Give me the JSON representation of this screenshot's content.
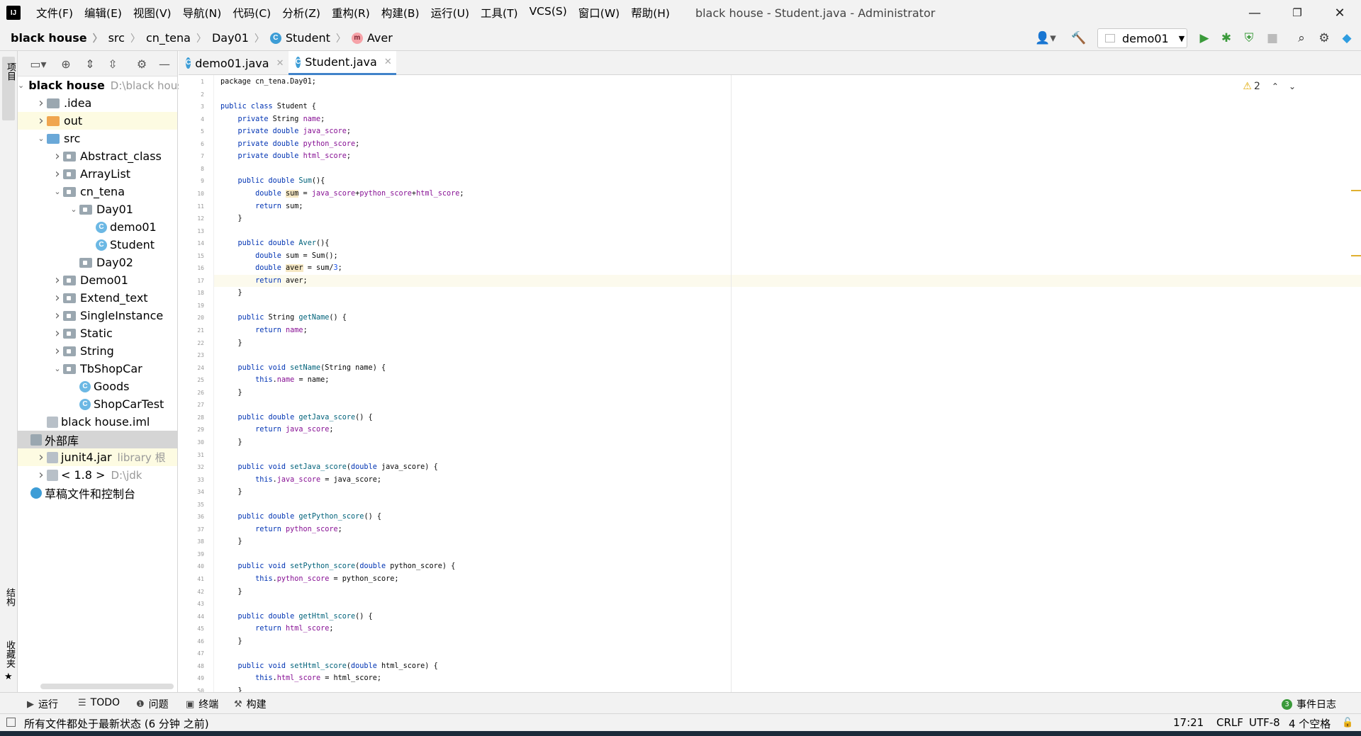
{
  "window": {
    "title": "black house - Student.java - Administrator",
    "menus": [
      "文件(F)",
      "编辑(E)",
      "视图(V)",
      "导航(N)",
      "代码(C)",
      "分析(Z)",
      "重构(R)",
      "构建(B)",
      "运行(U)",
      "工具(T)",
      "VCS(S)",
      "窗口(W)",
      "帮助(H)"
    ],
    "controls": {
      "minimize": "—",
      "restore": "❐",
      "close": "✕"
    }
  },
  "breadcrumb": {
    "project": "black house",
    "items": [
      "src",
      "cn_tena",
      "Day01",
      "Student",
      "Aver"
    ],
    "class_badge": "C",
    "method_badge": "m"
  },
  "toolbar": {
    "run_config": "demo01",
    "icons": [
      "user-icon",
      "hammer-icon",
      "run-icon",
      "debug-icon",
      "coverage-icon",
      "stop-icon",
      "search-icon",
      "gear-icon",
      "plugin-icon"
    ]
  },
  "left_strip": {
    "project_label": "项目",
    "structure_label": "结构",
    "favorites_label": "收藏夹"
  },
  "project_tree": [
    {
      "label": "black house",
      "hint": "D:\\black house",
      "indent": 0,
      "arrow": "down",
      "icon": "folder-gray",
      "bold": true
    },
    {
      "label": ".idea",
      "indent": 1,
      "arrow": "right",
      "icon": "folder-gray"
    },
    {
      "label": "out",
      "indent": 1,
      "arrow": "right",
      "icon": "folder-orange",
      "highlight": true
    },
    {
      "label": "src",
      "indent": 1,
      "arrow": "down",
      "icon": "folder-blue"
    },
    {
      "label": "Abstract_class",
      "indent": 2,
      "arrow": "right",
      "icon": "package"
    },
    {
      "label": "ArrayList",
      "indent": 2,
      "arrow": "right",
      "icon": "package"
    },
    {
      "label": "cn_tena",
      "indent": 2,
      "arrow": "down",
      "icon": "package"
    },
    {
      "label": "Day01",
      "indent": 3,
      "arrow": "down",
      "icon": "package"
    },
    {
      "label": "demo01",
      "indent": 4,
      "arrow": "",
      "icon": "class-run"
    },
    {
      "label": "Student",
      "indent": 4,
      "arrow": "",
      "icon": "class"
    },
    {
      "label": "Day02",
      "indent": 3,
      "arrow": "",
      "icon": "package"
    },
    {
      "label": "Demo01",
      "indent": 2,
      "arrow": "right",
      "icon": "package"
    },
    {
      "label": "Extend_text",
      "indent": 2,
      "arrow": "right",
      "icon": "package"
    },
    {
      "label": "SingleInstance",
      "indent": 2,
      "arrow": "right",
      "icon": "package"
    },
    {
      "label": "Static",
      "indent": 2,
      "arrow": "right",
      "icon": "package"
    },
    {
      "label": "String",
      "indent": 2,
      "arrow": "right",
      "icon": "package"
    },
    {
      "label": "TbShopCar",
      "indent": 2,
      "arrow": "down",
      "icon": "package"
    },
    {
      "label": "Goods",
      "indent": 3,
      "arrow": "",
      "icon": "class"
    },
    {
      "label": "ShopCarTest",
      "indent": 3,
      "arrow": "",
      "icon": "class-run"
    },
    {
      "label": "black house.iml",
      "indent": 1,
      "arrow": "",
      "icon": "iml"
    },
    {
      "label": "外部库",
      "indent": 0,
      "arrow": "",
      "icon": "library",
      "selected": true
    },
    {
      "label": "junit4.jar",
      "hint": "library 根",
      "indent": 1,
      "arrow": "right",
      "icon": "jar",
      "highlight": true
    },
    {
      "label": "< 1.8 >",
      "hint": "D:\\jdk",
      "indent": 1,
      "arrow": "right",
      "icon": "jdk"
    },
    {
      "label": "草稿文件和控制台",
      "indent": 0,
      "arrow": "",
      "icon": "scratch"
    }
  ],
  "tabs": [
    {
      "label": "demo01.java",
      "active": false
    },
    {
      "label": "Student.java",
      "active": true
    }
  ],
  "editor": {
    "warnings": "2",
    "current_line": 17,
    "lines": [
      [
        [
          "t",
          "package cn_tena.Day01;"
        ]
      ],
      [],
      [
        [
          "k",
          "public class "
        ],
        [
          "t",
          "Student {"
        ]
      ],
      [
        [
          "t",
          "    "
        ],
        [
          "k",
          "private "
        ],
        [
          "t",
          "String "
        ],
        [
          "f",
          "name"
        ],
        [
          "t",
          ";"
        ]
      ],
      [
        [
          "t",
          "    "
        ],
        [
          "k",
          "private double "
        ],
        [
          "f",
          "java_score"
        ],
        [
          "t",
          ";"
        ]
      ],
      [
        [
          "t",
          "    "
        ],
        [
          "k",
          "private double "
        ],
        [
          "f",
          "python_score"
        ],
        [
          "t",
          ";"
        ]
      ],
      [
        [
          "t",
          "    "
        ],
        [
          "k",
          "private double "
        ],
        [
          "f",
          "html_score"
        ],
        [
          "t",
          ";"
        ]
      ],
      [],
      [
        [
          "t",
          "    "
        ],
        [
          "k",
          "public double "
        ],
        [
          "m",
          "Sum"
        ],
        [
          "t",
          "(){"
        ]
      ],
      [
        [
          "t",
          "        "
        ],
        [
          "k",
          "double "
        ],
        [
          "h",
          "sum"
        ],
        [
          "t",
          " = "
        ],
        [
          "f",
          "java_score"
        ],
        [
          "t",
          "+"
        ],
        [
          "f",
          "python_score"
        ],
        [
          "t",
          "+"
        ],
        [
          "f",
          "html_score"
        ],
        [
          "t",
          ";"
        ]
      ],
      [
        [
          "t",
          "        "
        ],
        [
          "k",
          "return "
        ],
        [
          "t",
          "sum;"
        ]
      ],
      [
        [
          "t",
          "    }"
        ]
      ],
      [],
      [
        [
          "t",
          "    "
        ],
        [
          "k",
          "public double "
        ],
        [
          "m",
          "Aver"
        ],
        [
          "t",
          "(){"
        ]
      ],
      [
        [
          "t",
          "        "
        ],
        [
          "k",
          "double "
        ],
        [
          "t",
          "sum = Sum();"
        ]
      ],
      [
        [
          "t",
          "        "
        ],
        [
          "k",
          "double "
        ],
        [
          "h",
          "aver"
        ],
        [
          "t",
          " = sum/"
        ],
        [
          "n",
          "3"
        ],
        [
          "t",
          ";"
        ]
      ],
      [
        [
          "t",
          "        "
        ],
        [
          "k",
          "return "
        ],
        [
          "t",
          "aver;"
        ]
      ],
      [
        [
          "t",
          "    }"
        ]
      ],
      [],
      [
        [
          "t",
          "    "
        ],
        [
          "k",
          "public "
        ],
        [
          "t",
          "String "
        ],
        [
          "m",
          "getName"
        ],
        [
          "t",
          "() {"
        ]
      ],
      [
        [
          "t",
          "        "
        ],
        [
          "k",
          "return "
        ],
        [
          "f",
          "name"
        ],
        [
          "t",
          ";"
        ]
      ],
      [
        [
          "t",
          "    }"
        ]
      ],
      [],
      [
        [
          "t",
          "    "
        ],
        [
          "k",
          "public void "
        ],
        [
          "m",
          "setName"
        ],
        [
          "t",
          "(String name) {"
        ]
      ],
      [
        [
          "t",
          "        "
        ],
        [
          "k",
          "this"
        ],
        [
          "t",
          "."
        ],
        [
          "f",
          "name"
        ],
        [
          "t",
          " = name;"
        ]
      ],
      [
        [
          "t",
          "    }"
        ]
      ],
      [],
      [
        [
          "t",
          "    "
        ],
        [
          "k",
          "public double "
        ],
        [
          "m",
          "getJava_score"
        ],
        [
          "t",
          "() {"
        ]
      ],
      [
        [
          "t",
          "        "
        ],
        [
          "k",
          "return "
        ],
        [
          "f",
          "java_score"
        ],
        [
          "t",
          ";"
        ]
      ],
      [
        [
          "t",
          "    }"
        ]
      ],
      [],
      [
        [
          "t",
          "    "
        ],
        [
          "k",
          "public void "
        ],
        [
          "m",
          "setJava_score"
        ],
        [
          "t",
          "("
        ],
        [
          "k",
          "double "
        ],
        [
          "t",
          "java_score) {"
        ]
      ],
      [
        [
          "t",
          "        "
        ],
        [
          "k",
          "this"
        ],
        [
          "t",
          "."
        ],
        [
          "f",
          "java_score"
        ],
        [
          "t",
          " = java_score;"
        ]
      ],
      [
        [
          "t",
          "    }"
        ]
      ],
      [],
      [
        [
          "t",
          "    "
        ],
        [
          "k",
          "public double "
        ],
        [
          "m",
          "getPython_score"
        ],
        [
          "t",
          "() {"
        ]
      ],
      [
        [
          "t",
          "        "
        ],
        [
          "k",
          "return "
        ],
        [
          "f",
          "python_score"
        ],
        [
          "t",
          ";"
        ]
      ],
      [
        [
          "t",
          "    }"
        ]
      ],
      [],
      [
        [
          "t",
          "    "
        ],
        [
          "k",
          "public void "
        ],
        [
          "m",
          "setPython_score"
        ],
        [
          "t",
          "("
        ],
        [
          "k",
          "double "
        ],
        [
          "t",
          "python_score) {"
        ]
      ],
      [
        [
          "t",
          "        "
        ],
        [
          "k",
          "this"
        ],
        [
          "t",
          "."
        ],
        [
          "f",
          "python_score"
        ],
        [
          "t",
          " = python_score;"
        ]
      ],
      [
        [
          "t",
          "    }"
        ]
      ],
      [],
      [
        [
          "t",
          "    "
        ],
        [
          "k",
          "public double "
        ],
        [
          "m",
          "getHtml_score"
        ],
        [
          "t",
          "() {"
        ]
      ],
      [
        [
          "t",
          "        "
        ],
        [
          "k",
          "return "
        ],
        [
          "f",
          "html_score"
        ],
        [
          "t",
          ";"
        ]
      ],
      [
        [
          "t",
          "    }"
        ]
      ],
      [],
      [
        [
          "t",
          "    "
        ],
        [
          "k",
          "public void "
        ],
        [
          "m",
          "setHtml_score"
        ],
        [
          "t",
          "("
        ],
        [
          "k",
          "double "
        ],
        [
          "t",
          "html_score) {"
        ]
      ],
      [
        [
          "t",
          "        "
        ],
        [
          "k",
          "this"
        ],
        [
          "t",
          "."
        ],
        [
          "f",
          "html_score"
        ],
        [
          "t",
          " = html_score;"
        ]
      ],
      [
        [
          "t",
          "    }"
        ]
      ]
    ]
  },
  "bottom_tools": [
    {
      "label": "运行",
      "icon": "play-icon"
    },
    {
      "label": "TODO",
      "icon": "list-icon"
    },
    {
      "label": "问题",
      "icon": "problems-icon"
    },
    {
      "label": "终端",
      "icon": "terminal-icon"
    },
    {
      "label": "构建",
      "icon": "hammer-icon"
    }
  ],
  "event_log": {
    "count": "3",
    "label": "事件日志"
  },
  "status": {
    "message": "所有文件都处于最新状态 (6 分钟 之前)",
    "position": "17:21",
    "line_sep": "CRLF",
    "encoding": "UTF-8",
    "indent": "4 个空格"
  },
  "colors": {
    "keyword": "#0033b3",
    "field": "#871094",
    "method": "#00627a",
    "number": "#1750eb",
    "accent": "#4083c9"
  }
}
